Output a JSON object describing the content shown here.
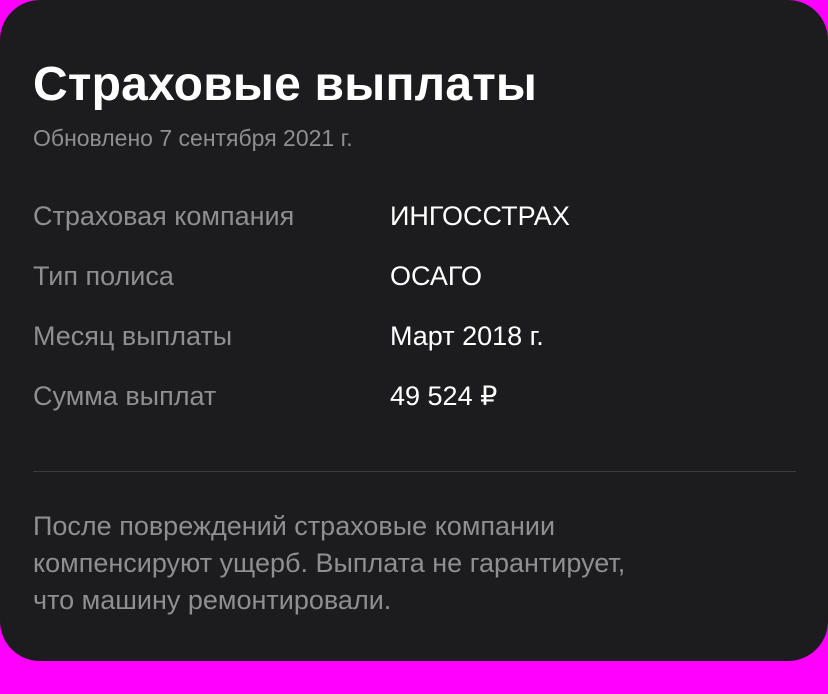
{
  "card": {
    "title": "Страховые выплаты",
    "updated": "Обновлено 7 сентября 2021 г."
  },
  "details": [
    {
      "label": "Страховая компания",
      "value": "ИНГОССТРАХ"
    },
    {
      "label": "Тип полиса",
      "value": "ОСАГО"
    },
    {
      "label": "Месяц выплаты",
      "value": "Март 2018 г."
    },
    {
      "label": "Сумма выплат",
      "value": "49 524 ₽"
    }
  ],
  "note": {
    "lines": [
      "После повреждений страховые компании",
      "компенсируют ущерб. Выплата не гарантирует,",
      "что машину ремонтировали."
    ]
  },
  "colors": {
    "background": "#ff00ff",
    "card": "#1c1c1e",
    "primary_text": "#ffffff",
    "secondary_text": "#8e8e93",
    "divider": "#3a3a3c"
  }
}
